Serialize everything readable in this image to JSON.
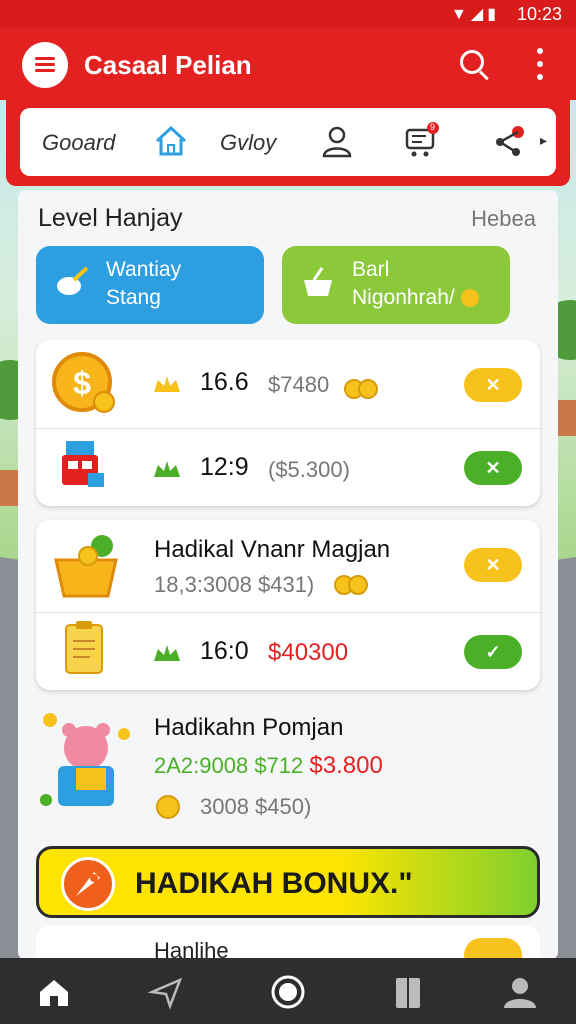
{
  "status_bar": {
    "time": "10:23",
    "icons": [
      "wifi-icon",
      "signal-icon",
      "battery-icon"
    ]
  },
  "app_bar": {
    "title": "Casaal Pelian",
    "icons": [
      "menu-icon",
      "search-icon",
      "more-vert-icon"
    ]
  },
  "tabs": [
    {
      "label": "Gooard"
    },
    {
      "icon": "home-icon"
    },
    {
      "label": "Gvloy"
    },
    {
      "icon": "user-icon"
    },
    {
      "icon": "cart-icon",
      "badge": "9"
    },
    {
      "icon": "share-icon"
    }
  ],
  "section": {
    "title": "Level Hanjay",
    "link": "Hebea"
  },
  "actions": [
    {
      "label_line1": "Wantiay",
      "label_line2": "Stang",
      "color": "#2d9fe0",
      "icon": "bowl-icon"
    },
    {
      "label_line1": "Barl",
      "label_line2": "Nigonhrah/",
      "color": "#8bc83a",
      "icon": "basket-icon"
    }
  ],
  "card1": {
    "rows": [
      {
        "icon": "dollar-coin-icon",
        "main": "16.6",
        "sub": "$7480",
        "button": "✕",
        "button_color": "#f7c21b"
      },
      {
        "icon": "cash-register-icon",
        "main": "12:9",
        "sub": "($5.300)",
        "button": "✕",
        "button_color": "#4caf28"
      }
    ]
  },
  "card2": {
    "title": "Hadikal Vnanr Magjan",
    "sub": "18,3:3008 $431)",
    "button": "✕",
    "row2": {
      "icon": "document-icon",
      "main": "16:0",
      "sub": "$40300",
      "button": "✓"
    }
  },
  "card3": {
    "title": "Hadikahn Pomjan",
    "line1_a": "2A2:9008",
    "line1_b": "$712",
    "line1_c": "$3.800",
    "line2": "3008 $450)",
    "icon": "bear-mascot-icon"
  },
  "bonus": {
    "text": "HADIKAH BONUX.\"",
    "icon": "rocket-icon"
  },
  "peek": {
    "title": "Hanlihe"
  },
  "bottom_nav": [
    "home-icon",
    "send-icon",
    "circle-icon",
    "book-icon",
    "profile-icon"
  ]
}
